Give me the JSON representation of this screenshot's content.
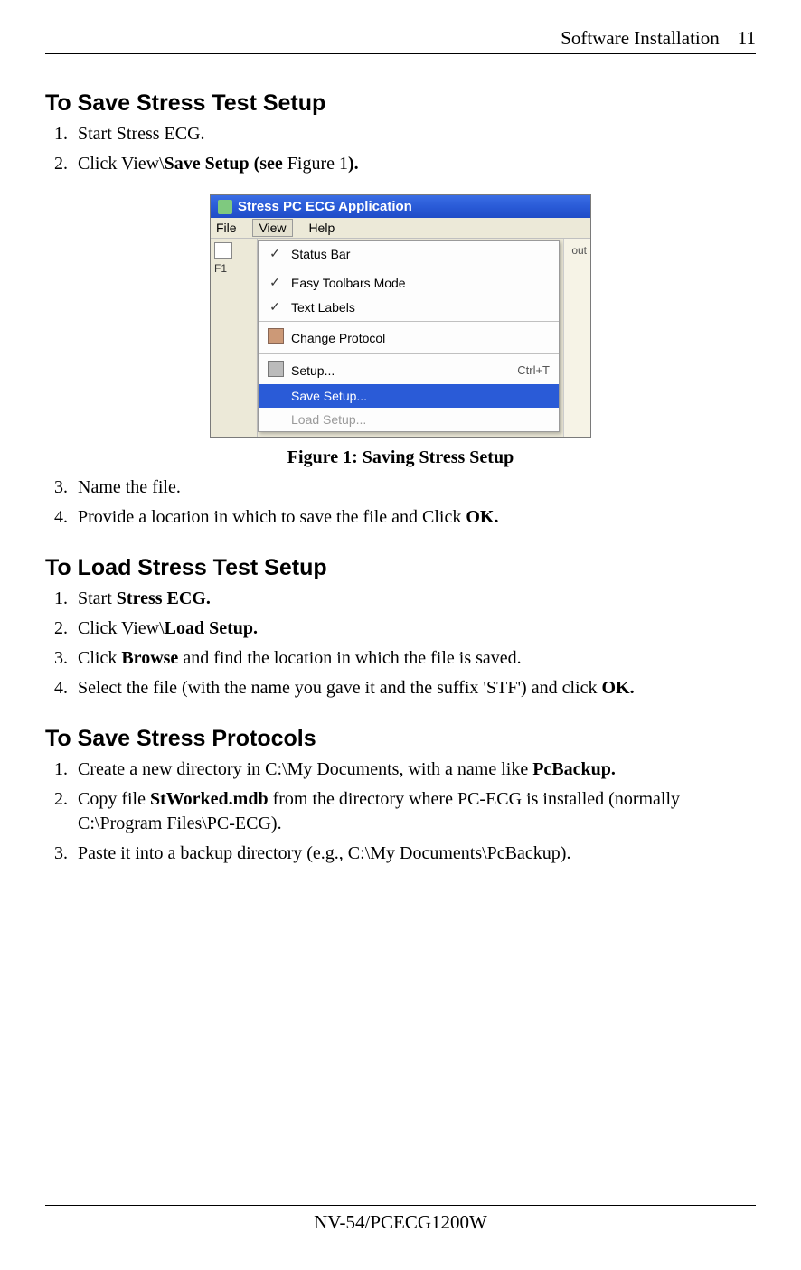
{
  "header": {
    "section": "Software Installation",
    "page": "11"
  },
  "footer": {
    "doc_id": "NV-54/PCECG1200W"
  },
  "sections": {
    "save_setup": {
      "title": "To Save Stress Test Setup",
      "items": {
        "i1": "Start Stress ECG.",
        "i2_a": "Click View\\",
        "i2_b": "Save Setup (see ",
        "i2_c": "Figure 1",
        "i2_d": ").",
        "i3": "Name the file.",
        "i4_a": "Provide a location in which to save the file and Click ",
        "i4_b": "OK."
      }
    },
    "load_setup": {
      "title": "To Load Stress Test Setup",
      "items": {
        "i1_a": "Start ",
        "i1_b": "Stress ECG.",
        "i2_a": "Click View\\",
        "i2_b": "Load Setup.",
        "i3_a": "Click ",
        "i3_b": "Browse",
        "i3_c": " and find the location in which the file is saved.",
        "i4_a": "Select the file (with the name you gave it and the suffix 'STF') and click ",
        "i4_b": "OK."
      }
    },
    "save_protocols": {
      "title": "To Save Stress Protocols",
      "items": {
        "i1_a": "Create a new directory in C:\\My Documents, with a name like ",
        "i1_b": "PcBackup.",
        "i2_a": "Copy file ",
        "i2_b": "StWorked.mdb",
        "i2_c": " from the directory where PC-ECG is installed (normally C:\\Program Files\\PC-ECG).",
        "i3": "Paste it into a backup directory (e.g., C:\\My Documents\\PcBackup)."
      }
    }
  },
  "figure": {
    "caption": "Figure 1: Saving Stress Setup",
    "window_title": "Stress PC ECG Application",
    "menubar": {
      "file": "File",
      "view": "View",
      "help": "Help"
    },
    "toolbar_left_label": "F1",
    "right_snip": "out",
    "menu": {
      "status_bar": "Status Bar",
      "easy_toolbars": "Easy Toolbars Mode",
      "text_labels": "Text Labels",
      "change_protocol": "Change Protocol",
      "setup": "Setup...",
      "setup_shortcut": "Ctrl+T",
      "save_setup": "Save Setup...",
      "load_setup": "Load Setup..."
    }
  }
}
